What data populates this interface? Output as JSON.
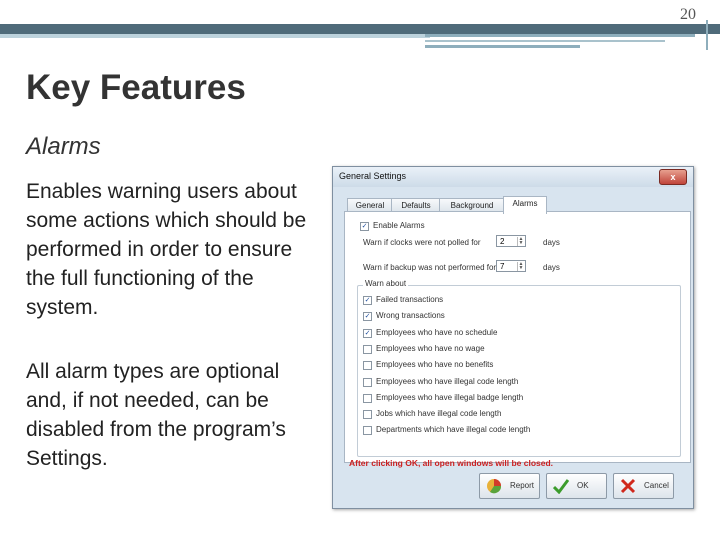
{
  "page_number": "20",
  "title": "Key Features",
  "subtitle": "Alarms",
  "paragraph1": "Enables warning users about some actions which should be performed in order to ensure the full functioning of the system.",
  "paragraph2": "All alarm types are optional and,  if not needed, can be disabled from the program’s Settings.",
  "dialog": {
    "title": "General Settings",
    "close": "x",
    "tabs": [
      "General",
      "Defaults",
      "Background",
      "Alarms"
    ],
    "enable_alarms": "Enable Alarms",
    "warn_clocks_label": "Warn if clocks were not polled for",
    "warn_clocks_value": "2",
    "warn_clocks_unit": "days",
    "warn_backup_label": "Warn if backup was not performed for",
    "warn_backup_value": "7",
    "warn_backup_unit": "days",
    "warn_about_title": "Warn about",
    "items": [
      {
        "label": "Failed transactions",
        "checked": true
      },
      {
        "label": "Wrong transactions",
        "checked": true
      },
      {
        "label": "Employees who have no schedule",
        "checked": true
      },
      {
        "label": "Employees who have no wage",
        "checked": false
      },
      {
        "label": "Employees who have no benefits",
        "checked": false
      },
      {
        "label": "Employees who have illegal code length",
        "checked": false
      },
      {
        "label": "Employees who have illegal badge length",
        "checked": false
      },
      {
        "label": "Jobs which have illegal code length",
        "checked": false
      },
      {
        "label": "Departments which have illegal code length",
        "checked": false
      }
    ],
    "warning": "After clicking OK, all open windows will be closed.",
    "report_button": "Report",
    "ok_button": "OK",
    "cancel_button": "Cancel",
    "check_mark": "✓"
  }
}
